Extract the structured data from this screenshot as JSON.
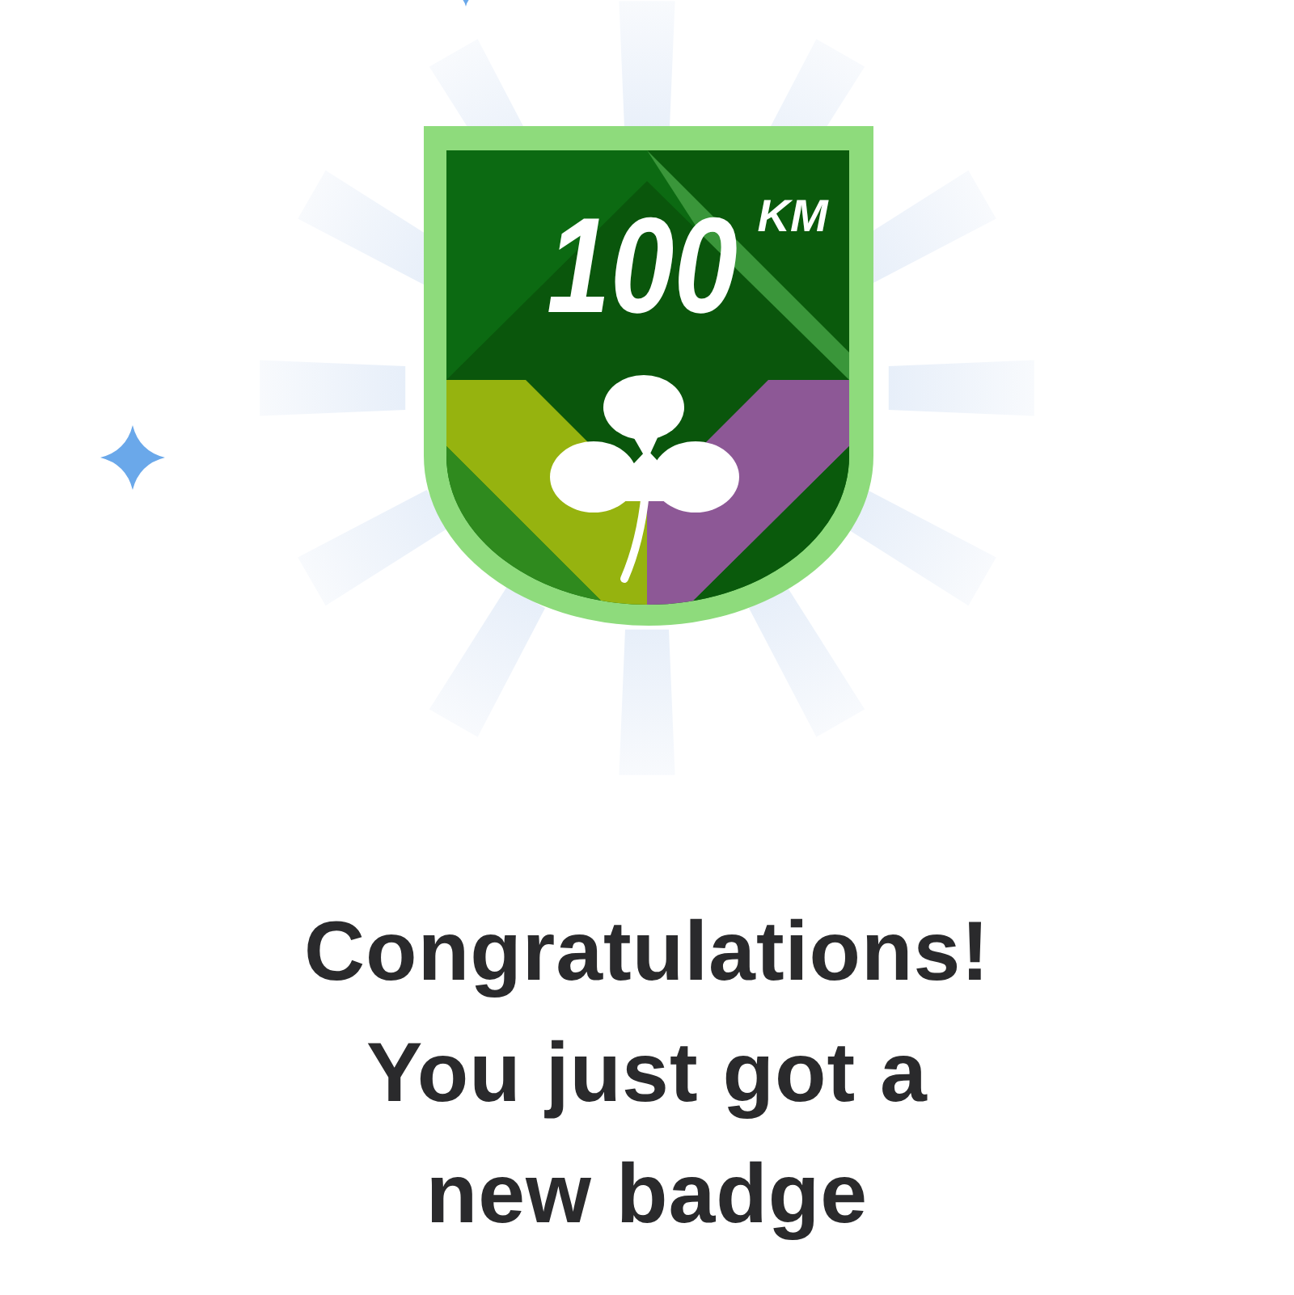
{
  "badge": {
    "value": "100",
    "unit": "KM"
  },
  "message": "Congratulations!\nYou just got a\nnew badge"
}
